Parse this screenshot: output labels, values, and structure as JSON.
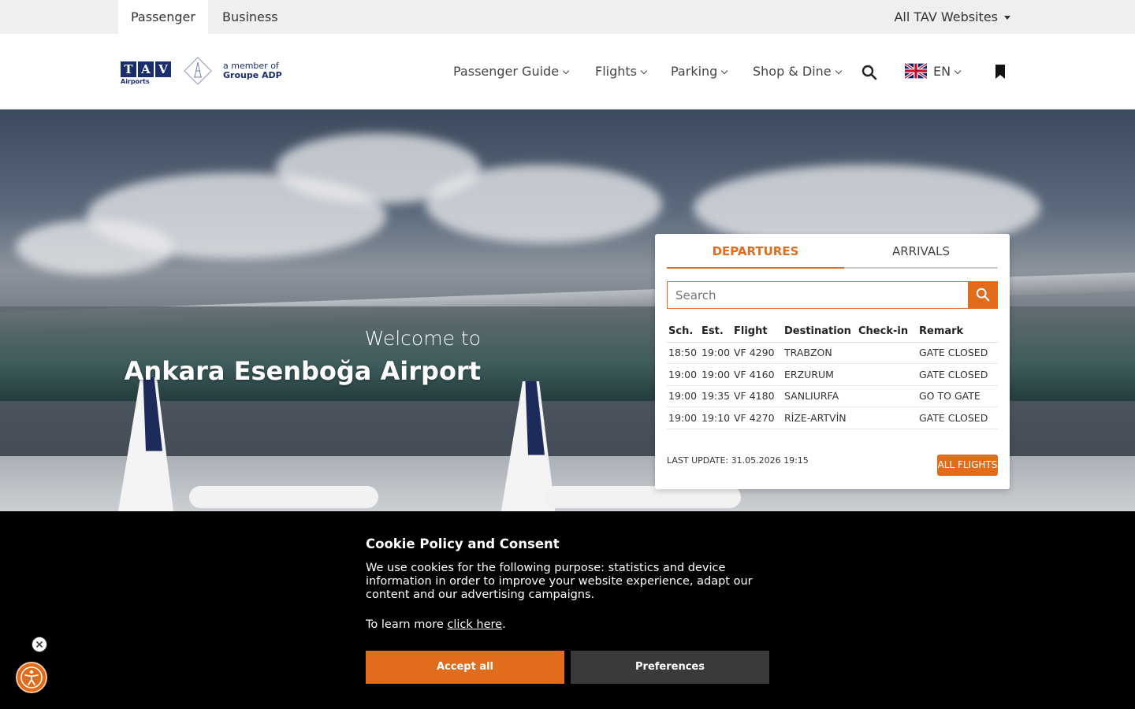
{
  "topbar": {
    "tabs": [
      {
        "label": "Passenger"
      },
      {
        "label": "Business"
      }
    ],
    "all_sites": "All TAV Websites"
  },
  "header": {
    "logo_letters": [
      "T",
      "A",
      "V"
    ],
    "logo_sub": "Airports",
    "member_line1": "a member of",
    "member_line2": "Groupe ADP",
    "nav": [
      {
        "label": "Passenger Guide"
      },
      {
        "label": "Flights"
      },
      {
        "label": "Parking"
      },
      {
        "label": "Shop & Dine"
      }
    ],
    "lang": "EN"
  },
  "hero": {
    "welcome": "Welcome to",
    "airport": "Ankara Esenboğa Airport"
  },
  "flights": {
    "tabs": {
      "departures": "DEPARTURES",
      "arrivals": "ARRIVALS"
    },
    "search_placeholder": "Search",
    "columns": [
      "Sch.",
      "Est.",
      "Flight",
      "Destination",
      "Check-in",
      "Remark"
    ],
    "rows": [
      {
        "sch": "18:50",
        "est": "19:00",
        "flight": "VF 4290",
        "dest": "TRABZON",
        "checkin": "",
        "remark": "GATE CLOSED"
      },
      {
        "sch": "19:00",
        "est": "19:00",
        "flight": "VF 4160",
        "dest": "ERZURUM",
        "checkin": "",
        "remark": "GATE CLOSED"
      },
      {
        "sch": "19:00",
        "est": "19:35",
        "flight": "VF 4180",
        "dest": "SANLIURFA",
        "checkin": "",
        "remark": "GO TO GATE"
      },
      {
        "sch": "19:00",
        "est": "19:10",
        "flight": "VF 4270",
        "dest": "RİZE-ARTVİN",
        "checkin": "",
        "remark": "GATE CLOSED"
      }
    ],
    "last_update": "LAST UPDATE: 31.05.2026 19:15",
    "all_flights": "ALL FLIGHTS"
  },
  "cookie": {
    "title": "Cookie Policy and Consent",
    "description": "We use cookies for the following purpose: statistics and device information in order to improve your website experience, adapt our content and our advertising campaigns.",
    "learn_prefix": "To learn more ",
    "learn_link": "click here",
    "learn_suffix": ".",
    "accept": "Accept all",
    "preferences": "Preferences"
  },
  "colors": {
    "accent": "#e06c1c",
    "brand_navy": "#1a2d6d",
    "topbar_bg": "#efeff1"
  }
}
